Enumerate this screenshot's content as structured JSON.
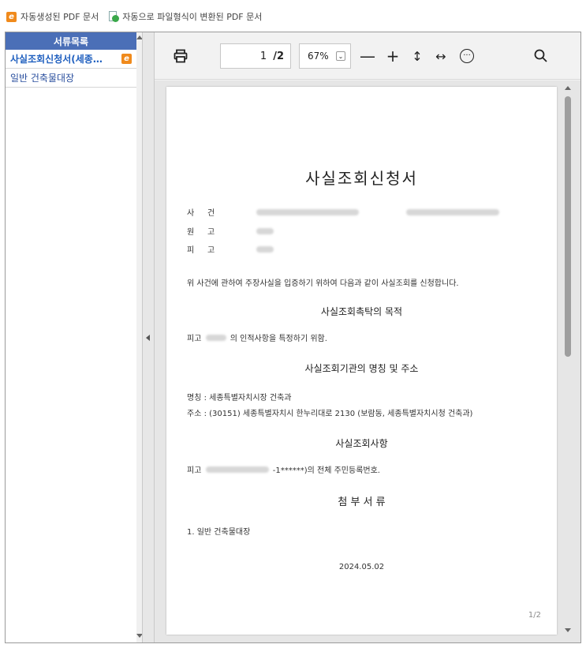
{
  "legend": {
    "auto_generated": "자동생성된 PDF 문서",
    "auto_converted": "자동으로 파일형식이 변환된 PDF 문서"
  },
  "sidebar": {
    "header": "서류목록",
    "items": [
      {
        "label": "사실조회신청서(세종…",
        "selected": true
      },
      {
        "label": "일반 건축물대장",
        "selected": false
      }
    ]
  },
  "toolbar": {
    "current_page": "1",
    "total_pages": "/2",
    "zoom": "67%",
    "zoom_out": "—",
    "zoom_in": "+",
    "fit_height": "↕",
    "fit_width": "↔",
    "more": "···"
  },
  "document": {
    "title": "사실조회신청서",
    "case_label_1": "사",
    "case_label_2": "건",
    "plaintiff_label_1": "원",
    "plaintiff_label_2": "고",
    "defendant_label_1": "피",
    "defendant_label_2": "고",
    "intro": "위 사건에 관하여 주장사실을 입증하기 위하여 다음과 같이 사실조회를 신청합니다.",
    "h_purpose": "사실조회촉탁의 목적",
    "purpose_prefix": "피고",
    "purpose_suffix": "의 인적사항을 특정하기 위함.",
    "h_institution": "사실조회기관의 명칭 및 주소",
    "inst_name": "명칭 : 세종특별자치시장 건축과",
    "inst_addr": "주소 : (30151)  세종특별자치시 한누리대로 2130  (보람동, 세종특별자치시청 건축과)",
    "h_items": "사실조회사항",
    "items_prefix": "피고",
    "items_suffix": "-1******)의 전체 주민등록번호.",
    "h_attach": "첨 부 서 류",
    "attach_1": "1.    일반 건축물대장",
    "date": "2024.05.02",
    "page_number": "1/2"
  },
  "colors": {
    "sidebar_header": "#4b6fb7",
    "selected_item": "#1f5fbf",
    "icon_orange": "#f08a1c"
  }
}
